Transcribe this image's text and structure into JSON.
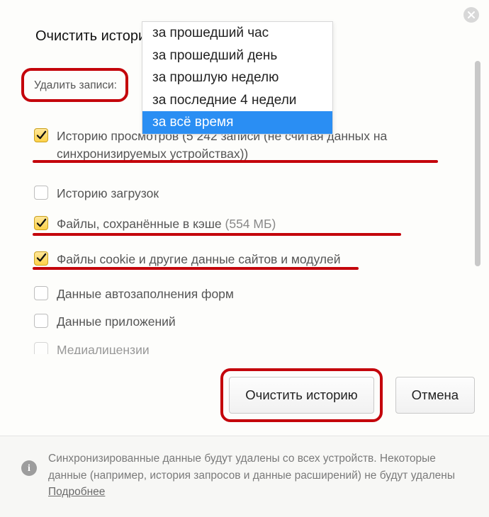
{
  "dialog": {
    "title": "Очистить историю",
    "delete_records_label": "Удалить записи:"
  },
  "dropdown": {
    "items": [
      {
        "label": "за прошедший час"
      },
      {
        "label": "за прошедший день"
      },
      {
        "label": "за прошлую неделю"
      },
      {
        "label": "за последние 4 недели"
      },
      {
        "label": "за всё время",
        "selected": true
      }
    ]
  },
  "checks": {
    "history_views": {
      "checked": true,
      "text": "Историю просмотров (5 242 записи (не считая данных на синхронизируемых устройствах))"
    },
    "history_downloads": {
      "checked": false,
      "text": "Историю загрузок"
    },
    "cached_files": {
      "checked": true,
      "text": "Файлы, сохранённые в кэше",
      "suffix": "(554 МБ)"
    },
    "cookies": {
      "checked": true,
      "text": "Файлы cookie и другие данные сайтов и модулей"
    },
    "autofill": {
      "checked": false,
      "text": "Данные автозаполнения форм"
    },
    "app_data": {
      "checked": false,
      "text": "Данные приложений"
    },
    "media_licenses": {
      "checked": false,
      "text": "Медиалицензии"
    }
  },
  "buttons": {
    "clear": "Очистить историю",
    "cancel": "Отмена"
  },
  "footer": {
    "text": "Синхронизированные данные будут удалены со всех устройств. Некоторые данные (например, история запросов и данные расширений) не будут удалены ",
    "more": "Подробнее"
  }
}
